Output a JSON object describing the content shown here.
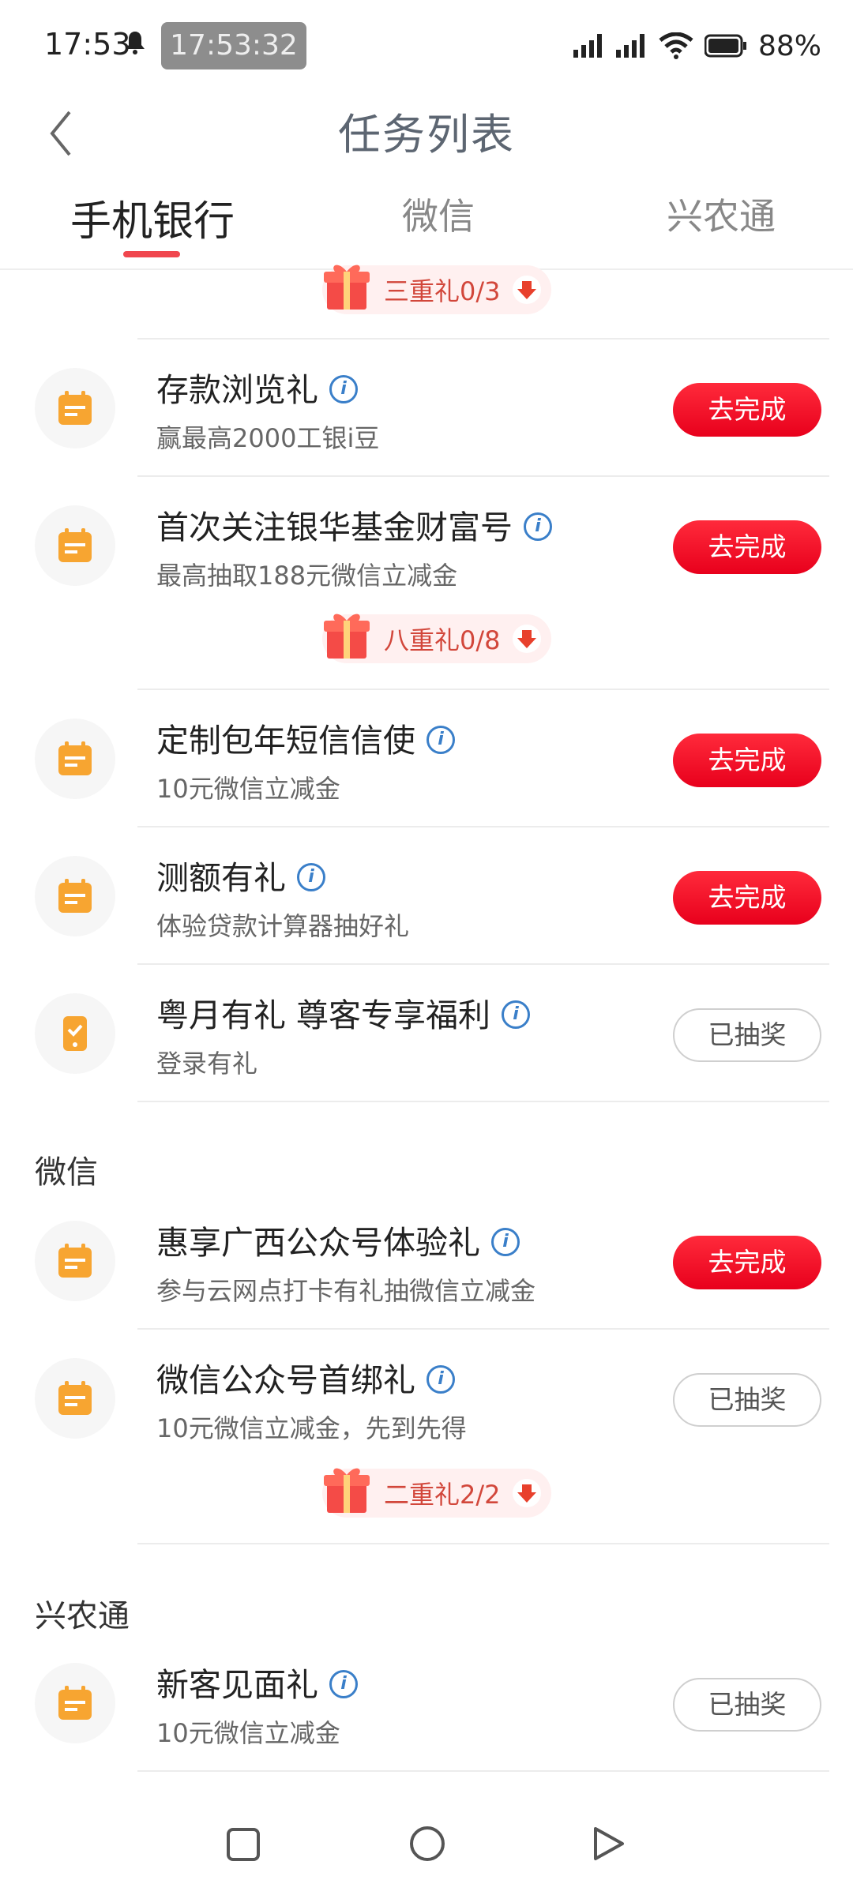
{
  "status_bar": {
    "time": "17:53",
    "pill_text": "17:53:32",
    "battery": "88%"
  },
  "header": {
    "title": "任务列表"
  },
  "tabs": [
    "手机银行",
    "微信",
    "兴农通"
  ],
  "gifts": [
    {
      "text": "三重礼0/3"
    },
    {
      "text": "八重礼0/8"
    },
    {
      "text": "二重礼2/2"
    }
  ],
  "sections": {
    "wechat": "微信",
    "xingnongtong": "兴农通"
  },
  "tasks": [
    {
      "title": "存款浏览礼",
      "sub": "赢最高2000工银i豆",
      "button": "去完成",
      "icon": "calendar-icon"
    },
    {
      "title": "首次关注银华基金财富号",
      "sub": "最高抽取188元微信立减金",
      "button": "去完成",
      "icon": "calendar-icon"
    },
    {
      "title": "定制包年短信信使",
      "sub": "10元微信立减金",
      "button": "去完成",
      "icon": "calendar-icon"
    },
    {
      "title": "测额有礼",
      "sub": "体验贷款计算器抽好礼",
      "button": "去完成",
      "icon": "calendar-icon"
    },
    {
      "title": "粤月有礼 尊客专享福利",
      "sub": "登录有礼",
      "button": "已抽奖",
      "icon": "phone-check-icon"
    },
    {
      "title": "惠享广西公众号体验礼",
      "sub": "参与云网点打卡有礼抽微信立减金",
      "button": "去完成",
      "icon": "calendar-icon"
    },
    {
      "title": "微信公众号首绑礼",
      "sub": "10元微信立减金，先到先得",
      "button": "已抽奖",
      "icon": "calendar-icon"
    },
    {
      "title": "新客见面礼",
      "sub": "10元微信立减金",
      "button": "已抽奖",
      "icon": "calendar-icon"
    }
  ],
  "colors": {
    "accent": "#f0464e",
    "button_red": "#e8001c",
    "icon_orange": "#f7a531"
  }
}
